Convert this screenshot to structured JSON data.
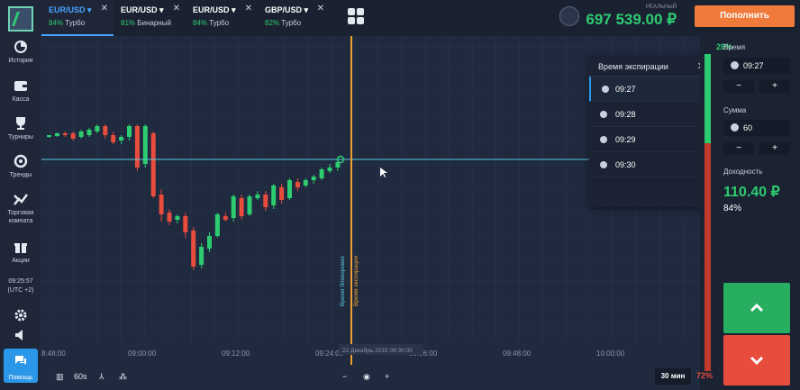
{
  "sidebar": {
    "items": [
      {
        "label": "История",
        "icon": "pie-chart-icon"
      },
      {
        "label": "Касса",
        "icon": "wallet-icon"
      },
      {
        "label": "Турниры",
        "icon": "trophy-icon"
      },
      {
        "label": "Тренды",
        "icon": "trends-icon"
      },
      {
        "label": "Торговая комната",
        "icon": "trade-room-icon"
      },
      {
        "label": "Акции",
        "icon": "gift-icon"
      }
    ],
    "time": "09:25:57",
    "timezone": "(UTC +2)",
    "help_label": "Помощь"
  },
  "tabs": [
    {
      "pair": "EUR/USD",
      "percent": "84%",
      "mode": "Турбо",
      "active": true
    },
    {
      "pair": "EUR/USD",
      "percent": "81%",
      "mode": "Бинарный",
      "active": false
    },
    {
      "pair": "EUR/USD",
      "percent": "84%",
      "mode": "Турбо",
      "active": false
    },
    {
      "pair": "GBP/USD",
      "percent": "82%",
      "mode": "Турбо",
      "active": false
    }
  ],
  "account": {
    "label": "РЕАЛЬНЫЙ",
    "balance": "697 539.00 ₽",
    "deposit_label": "Пополнить"
  },
  "chart": {
    "time_ticks": [
      "8:48:00",
      "09:00:00",
      "09:12:00",
      "09:24:00",
      "09:36:00",
      "09:48:00",
      "10:00:00"
    ],
    "purchase_line_label": "Время блокировки",
    "expiry_line_label": "Время экспирации",
    "cursor_date": "22 Декабрь 2015 09:30:00",
    "timeframe": "60s",
    "period": "30 мин",
    "colors": {
      "up": "#2ecc71",
      "down": "#e74c3c",
      "line": "#5ec8e0",
      "expiry": "#f0a030"
    }
  },
  "expiration_popup": {
    "title": "Время экспирации",
    "options": [
      "09:27",
      "09:28",
      "09:29",
      "09:30"
    ],
    "selected": "09:27"
  },
  "panel": {
    "sentiment_up": "28%",
    "sentiment_down": "72%",
    "sentiment_up_value": 0.28,
    "time_label": "Время",
    "time_value": "09:27",
    "amount_label": "Сумма",
    "amount_value": "60",
    "payout_label": "Доходность",
    "payout_value": "110.40 ₽",
    "payout_percent": "84%"
  }
}
